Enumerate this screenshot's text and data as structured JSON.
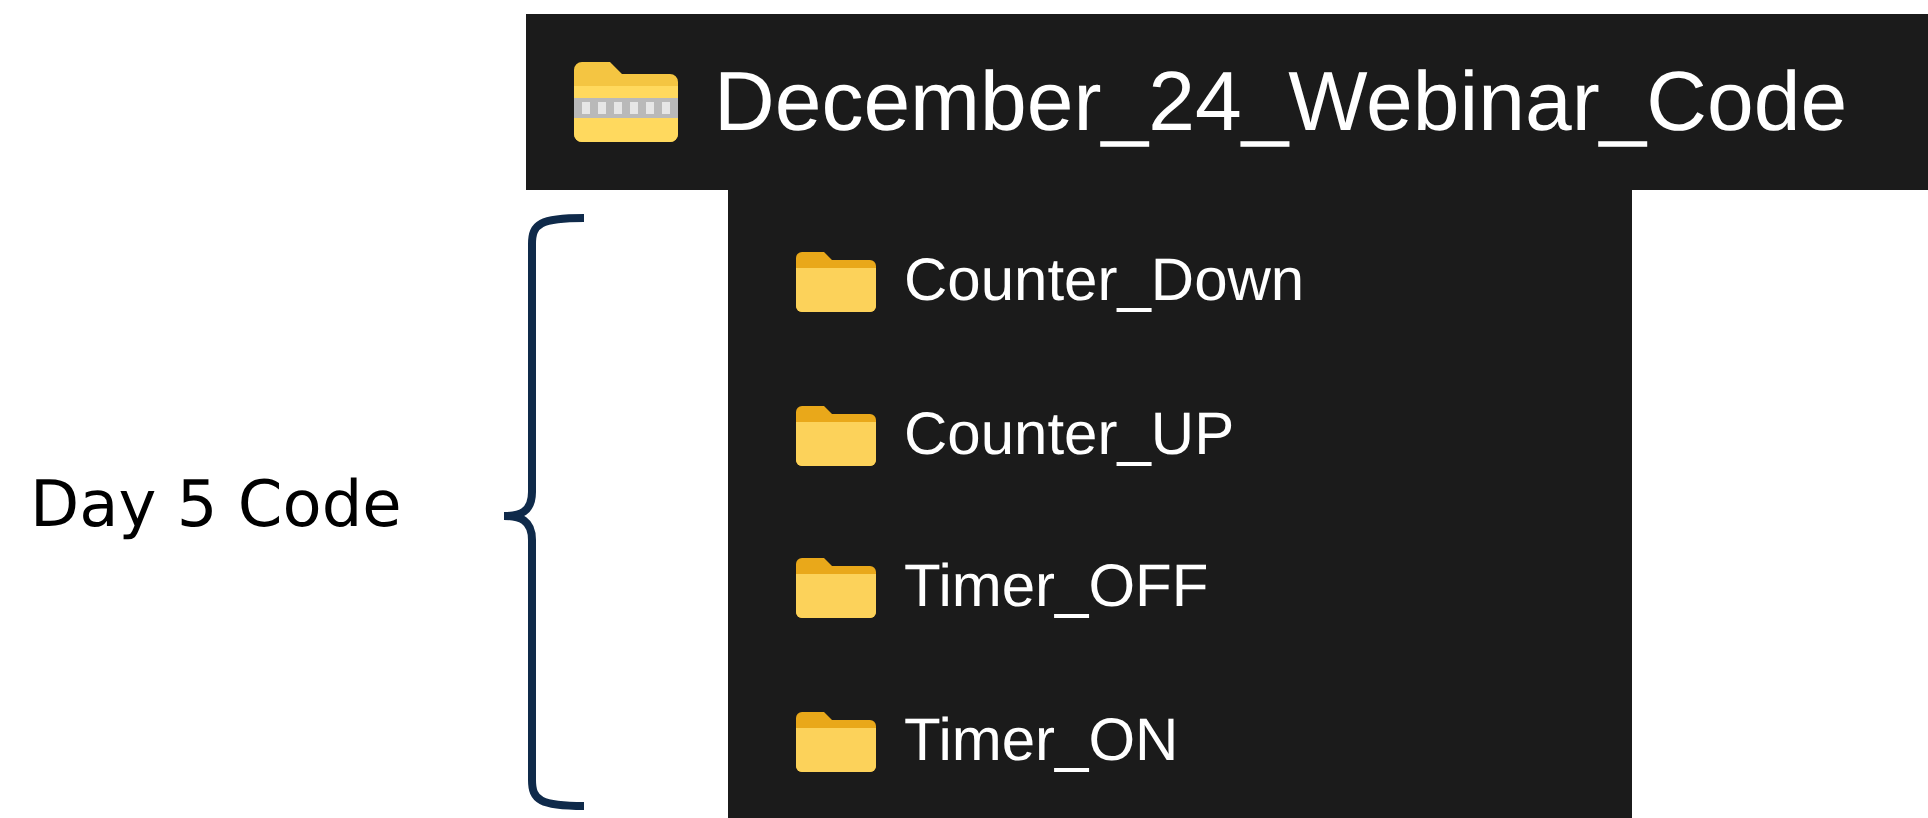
{
  "archive": {
    "name": "December_24_Webinar_Code"
  },
  "folders": [
    {
      "name": "Counter_Down"
    },
    {
      "name": "Counter_UP"
    },
    {
      "name": "Timer_OFF"
    },
    {
      "name": "Timer_ON"
    }
  ],
  "annotation": {
    "label": "Day 5 Code"
  }
}
